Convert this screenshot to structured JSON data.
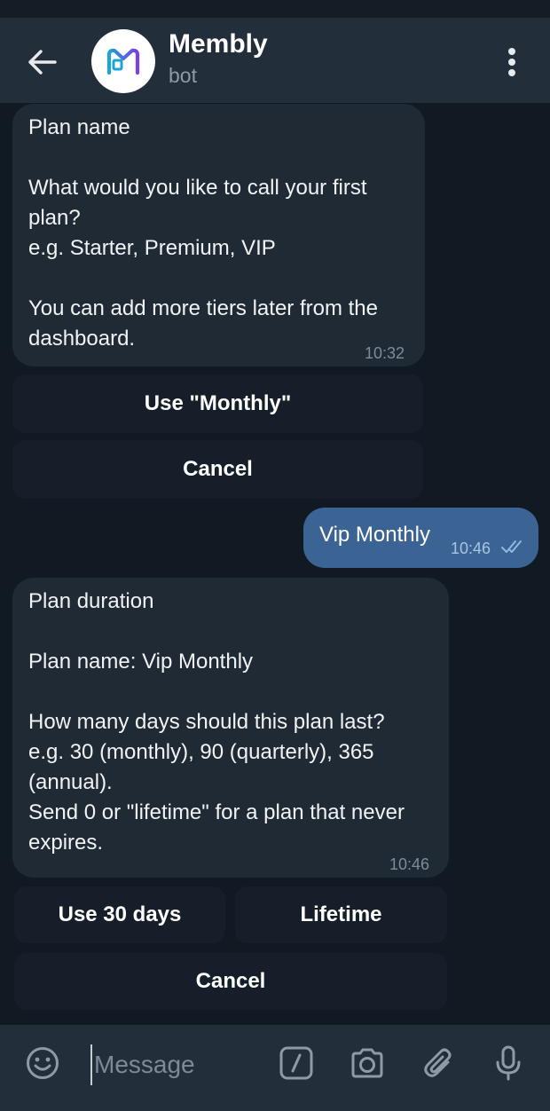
{
  "header": {
    "title": "Membly",
    "subtitle": "bot",
    "avatar_logo_text": "M",
    "avatar_logo_colors": [
      "#1aa5d6",
      "#7b3fe4"
    ]
  },
  "messages": [
    {
      "lines": [
        "Plan name",
        "",
        "What would you like to call your first",
        "plan?",
        "e.g. Starter, Premium, VIP",
        "",
        "You can add more tiers later from the",
        "dashboard."
      ],
      "time": "10:32",
      "buttons": [
        [
          "Use \"Monthly\""
        ],
        [
          "Cancel"
        ]
      ]
    },
    {
      "outgoing": true,
      "text": "Vip Monthly",
      "time": "10:46",
      "status_icon": "double-check-icon"
    },
    {
      "lines": [
        "Plan duration",
        "",
        "Plan name: Vip Monthly",
        "",
        "How many days should this plan last?",
        "e.g. 30 (monthly), 90 (quarterly), 365",
        "(annual).",
        "Send 0 or \"lifetime\" for a plan that never",
        "expires."
      ],
      "time": "10:46",
      "buttons": [
        [
          "Use 30 days",
          "Lifetime"
        ],
        [
          "Cancel"
        ]
      ]
    }
  ],
  "composer": {
    "placeholder": "Message",
    "icons": [
      "emoji-icon",
      "command-icon",
      "camera-icon",
      "attach-icon",
      "mic-icon"
    ]
  },
  "colors": {
    "background": "#111a23",
    "header": "#222e3a",
    "incoming_bubble": "#1f2a35",
    "outgoing_bubble": "#3b6495",
    "keyboard_button": "#161f29"
  }
}
